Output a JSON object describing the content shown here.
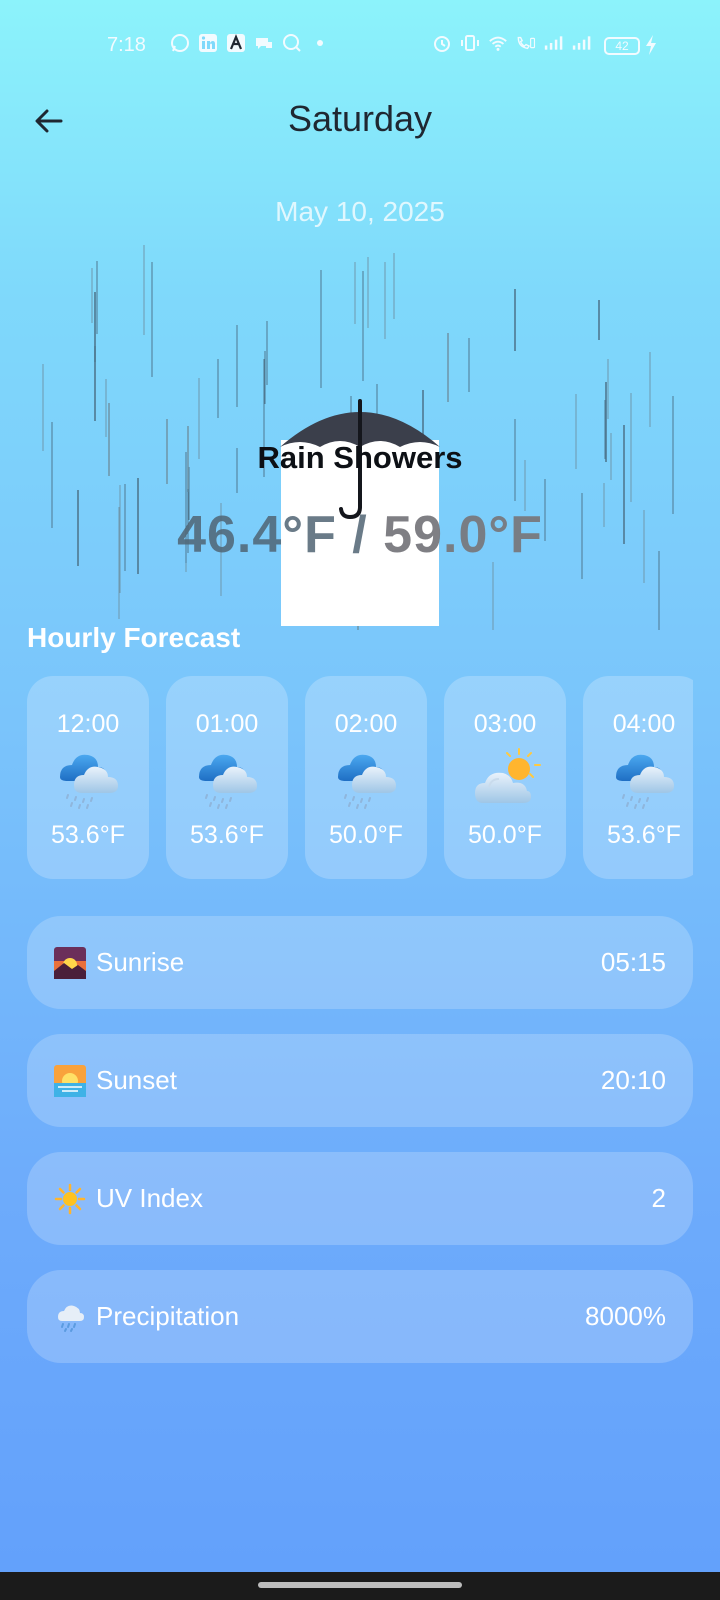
{
  "status_bar": {
    "time": "7:18",
    "battery": "42",
    "left_icons": [
      "whatsapp-icon",
      "linkedin-icon",
      "app-a-icon",
      "chat-icon",
      "search-icon",
      "dot-icon"
    ],
    "right_icons": [
      "alarm-icon",
      "vibrate-icon",
      "wifi-icon",
      "call-icon",
      "signal-icon",
      "signal-icon"
    ]
  },
  "header": {
    "title": "Saturday",
    "back_icon": "arrow-left-icon"
  },
  "date": "May 10, 2025",
  "weather": {
    "condition": "Rain Showers",
    "low": "46.4°F",
    "separator": " / ",
    "high": "59.0°F"
  },
  "hourly_title": "Hourly Forecast",
  "hourly": [
    {
      "time": "12:00",
      "icon": "rain-cloud-icon",
      "temp": "53.6°F"
    },
    {
      "time": "01:00",
      "icon": "rain-cloud-icon",
      "temp": "53.6°F"
    },
    {
      "time": "02:00",
      "icon": "rain-cloud-icon",
      "temp": "50.0°F"
    },
    {
      "time": "03:00",
      "icon": "sun-cloud-icon",
      "temp": "50.0°F"
    },
    {
      "time": "04:00",
      "icon": "rain-cloud-icon",
      "temp": "53.6°F"
    }
  ],
  "details": [
    {
      "icon": "sunrise-icon",
      "label": "Sunrise",
      "value": "05:15"
    },
    {
      "icon": "sunset-icon",
      "label": "Sunset",
      "value": "20:10"
    },
    {
      "icon": "sun-icon",
      "label": "UV Index",
      "value": "2"
    },
    {
      "icon": "rain-icon",
      "label": "Precipitation",
      "value": "8000%"
    }
  ],
  "colors": {
    "background_top": "#8cf3fb",
    "background_bottom": "#62a0fb",
    "title_text": "#1f2731"
  }
}
